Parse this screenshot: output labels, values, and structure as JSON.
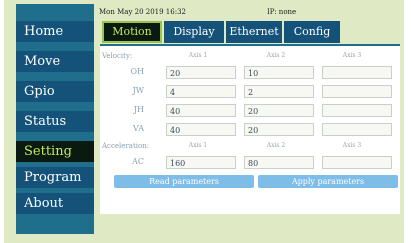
{
  "status_bar": {
    "datetime": "Mon May 20 2019 16:32",
    "ip": "IP: none"
  },
  "sidebar": {
    "items": [
      {
        "label": "Home"
      },
      {
        "label": "Move"
      },
      {
        "label": "Gpio"
      },
      {
        "label": "Status"
      },
      {
        "label": "Setting",
        "active": true
      },
      {
        "label": "Program"
      },
      {
        "label": "About"
      }
    ]
  },
  "tabs": [
    {
      "label": "Motion",
      "active": true
    },
    {
      "label": "Display"
    },
    {
      "label": "Ethernet"
    },
    {
      "label": "Config"
    }
  ],
  "velocity": {
    "section_label": "Velocity:",
    "axis_headers": [
      "Axis 1",
      "Axis 2",
      "Axis 3"
    ],
    "rows": [
      {
        "label": "OH",
        "values": [
          "20",
          "10",
          ""
        ]
      },
      {
        "label": "JW",
        "values": [
          "4",
          "2",
          ""
        ]
      },
      {
        "label": "JH",
        "values": [
          "40",
          "20",
          ""
        ]
      },
      {
        "label": "VA",
        "values": [
          "40",
          "20",
          ""
        ]
      }
    ]
  },
  "acceleration": {
    "section_label": "Acceleration:",
    "axis_headers": [
      "Axis 1",
      "Axis 2",
      "Axis 3"
    ],
    "rows": [
      {
        "label": "AC",
        "values": [
          "160",
          "80",
          ""
        ]
      }
    ]
  },
  "actions": {
    "read_label": "Read parameters",
    "apply_label": "Apply parameters"
  },
  "colors": {
    "sidebar": "#1f6f8c",
    "button": "#14527a",
    "active_bg": "#0a1a10",
    "active_text": "#c8e85a",
    "action_button": "#7dbde8",
    "screen_bg": "#dfe9c4"
  }
}
